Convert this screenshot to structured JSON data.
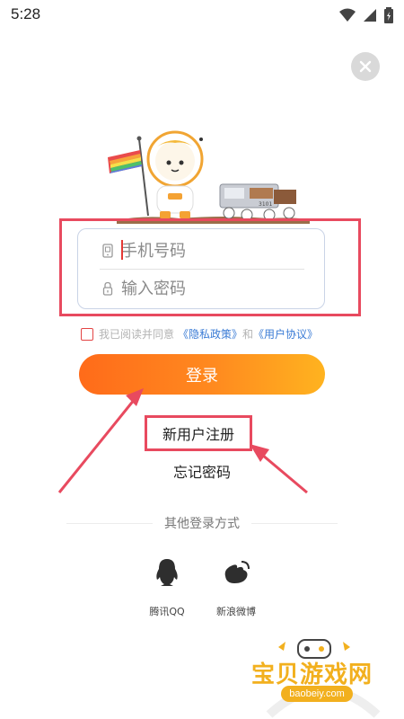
{
  "status_bar": {
    "time": "5:28",
    "icons": [
      "wifi-icon",
      "cellular-signal-icon",
      "battery-icon"
    ]
  },
  "close_icon": "close-icon",
  "login_form": {
    "phone_placeholder": "手机号码",
    "password_placeholder": "输入密码",
    "phone_icon": "phone-icon",
    "lock_icon": "lock-icon"
  },
  "agreement": {
    "prefix": "我已阅读并同意",
    "privacy_link": "《隐私政策》",
    "conjunction": "和",
    "terms_link": "《用户协议》"
  },
  "login_button": "登录",
  "register_link": "新用户注册",
  "forgot_link": "忘记密码",
  "other_login": {
    "title": "其他登录方式",
    "providers": [
      {
        "label": "腾讯QQ",
        "icon": "qq-penguin-icon"
      },
      {
        "label": "新浪微博",
        "icon": "weibo-icon"
      }
    ]
  },
  "watermark": {
    "text": "宝贝游戏网",
    "url": "baobeiy.com"
  },
  "colors": {
    "accent_orange": "#ff7a1a",
    "highlight_red": "#e84a5f",
    "link_blue": "#3a7bd5",
    "watermark_gold": "#f2b01e"
  }
}
